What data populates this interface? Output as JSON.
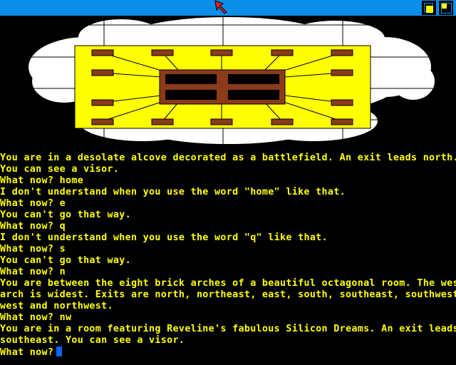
{
  "colors": {
    "titlebar": "#0a8ee8",
    "text": "#ffff00",
    "background": "#000000",
    "cursor": "#0a66ff",
    "cloud": "#ffffff",
    "floor": "#ffff00",
    "brick": "#8b3a1a"
  },
  "transcript": [
    "You are in a desolate alcove decorated as a battlefield. An exit leads north.",
    "You can see a visor.",
    "What now? home",
    "I don't understand when you use the word \"home\" like that.",
    "What now? e",
    "You can't go that way.",
    "What now? q",
    "I don't understand when you use the word \"q\" like that.",
    "What now? s",
    "You can't go that way.",
    "What now? n",
    "You are between the eight brick arches of a beautiful octagonal room. The west",
    "arch is widest. Exits are north, northeast, east, south, southeast, southwest,",
    "west and northwest.",
    "What now? nw",
    "You are in a room featuring Reveline's fabulous Silicon Dreams. An exit leads",
    "southeast. You can see a visor."
  ],
  "prompt": "What now?"
}
